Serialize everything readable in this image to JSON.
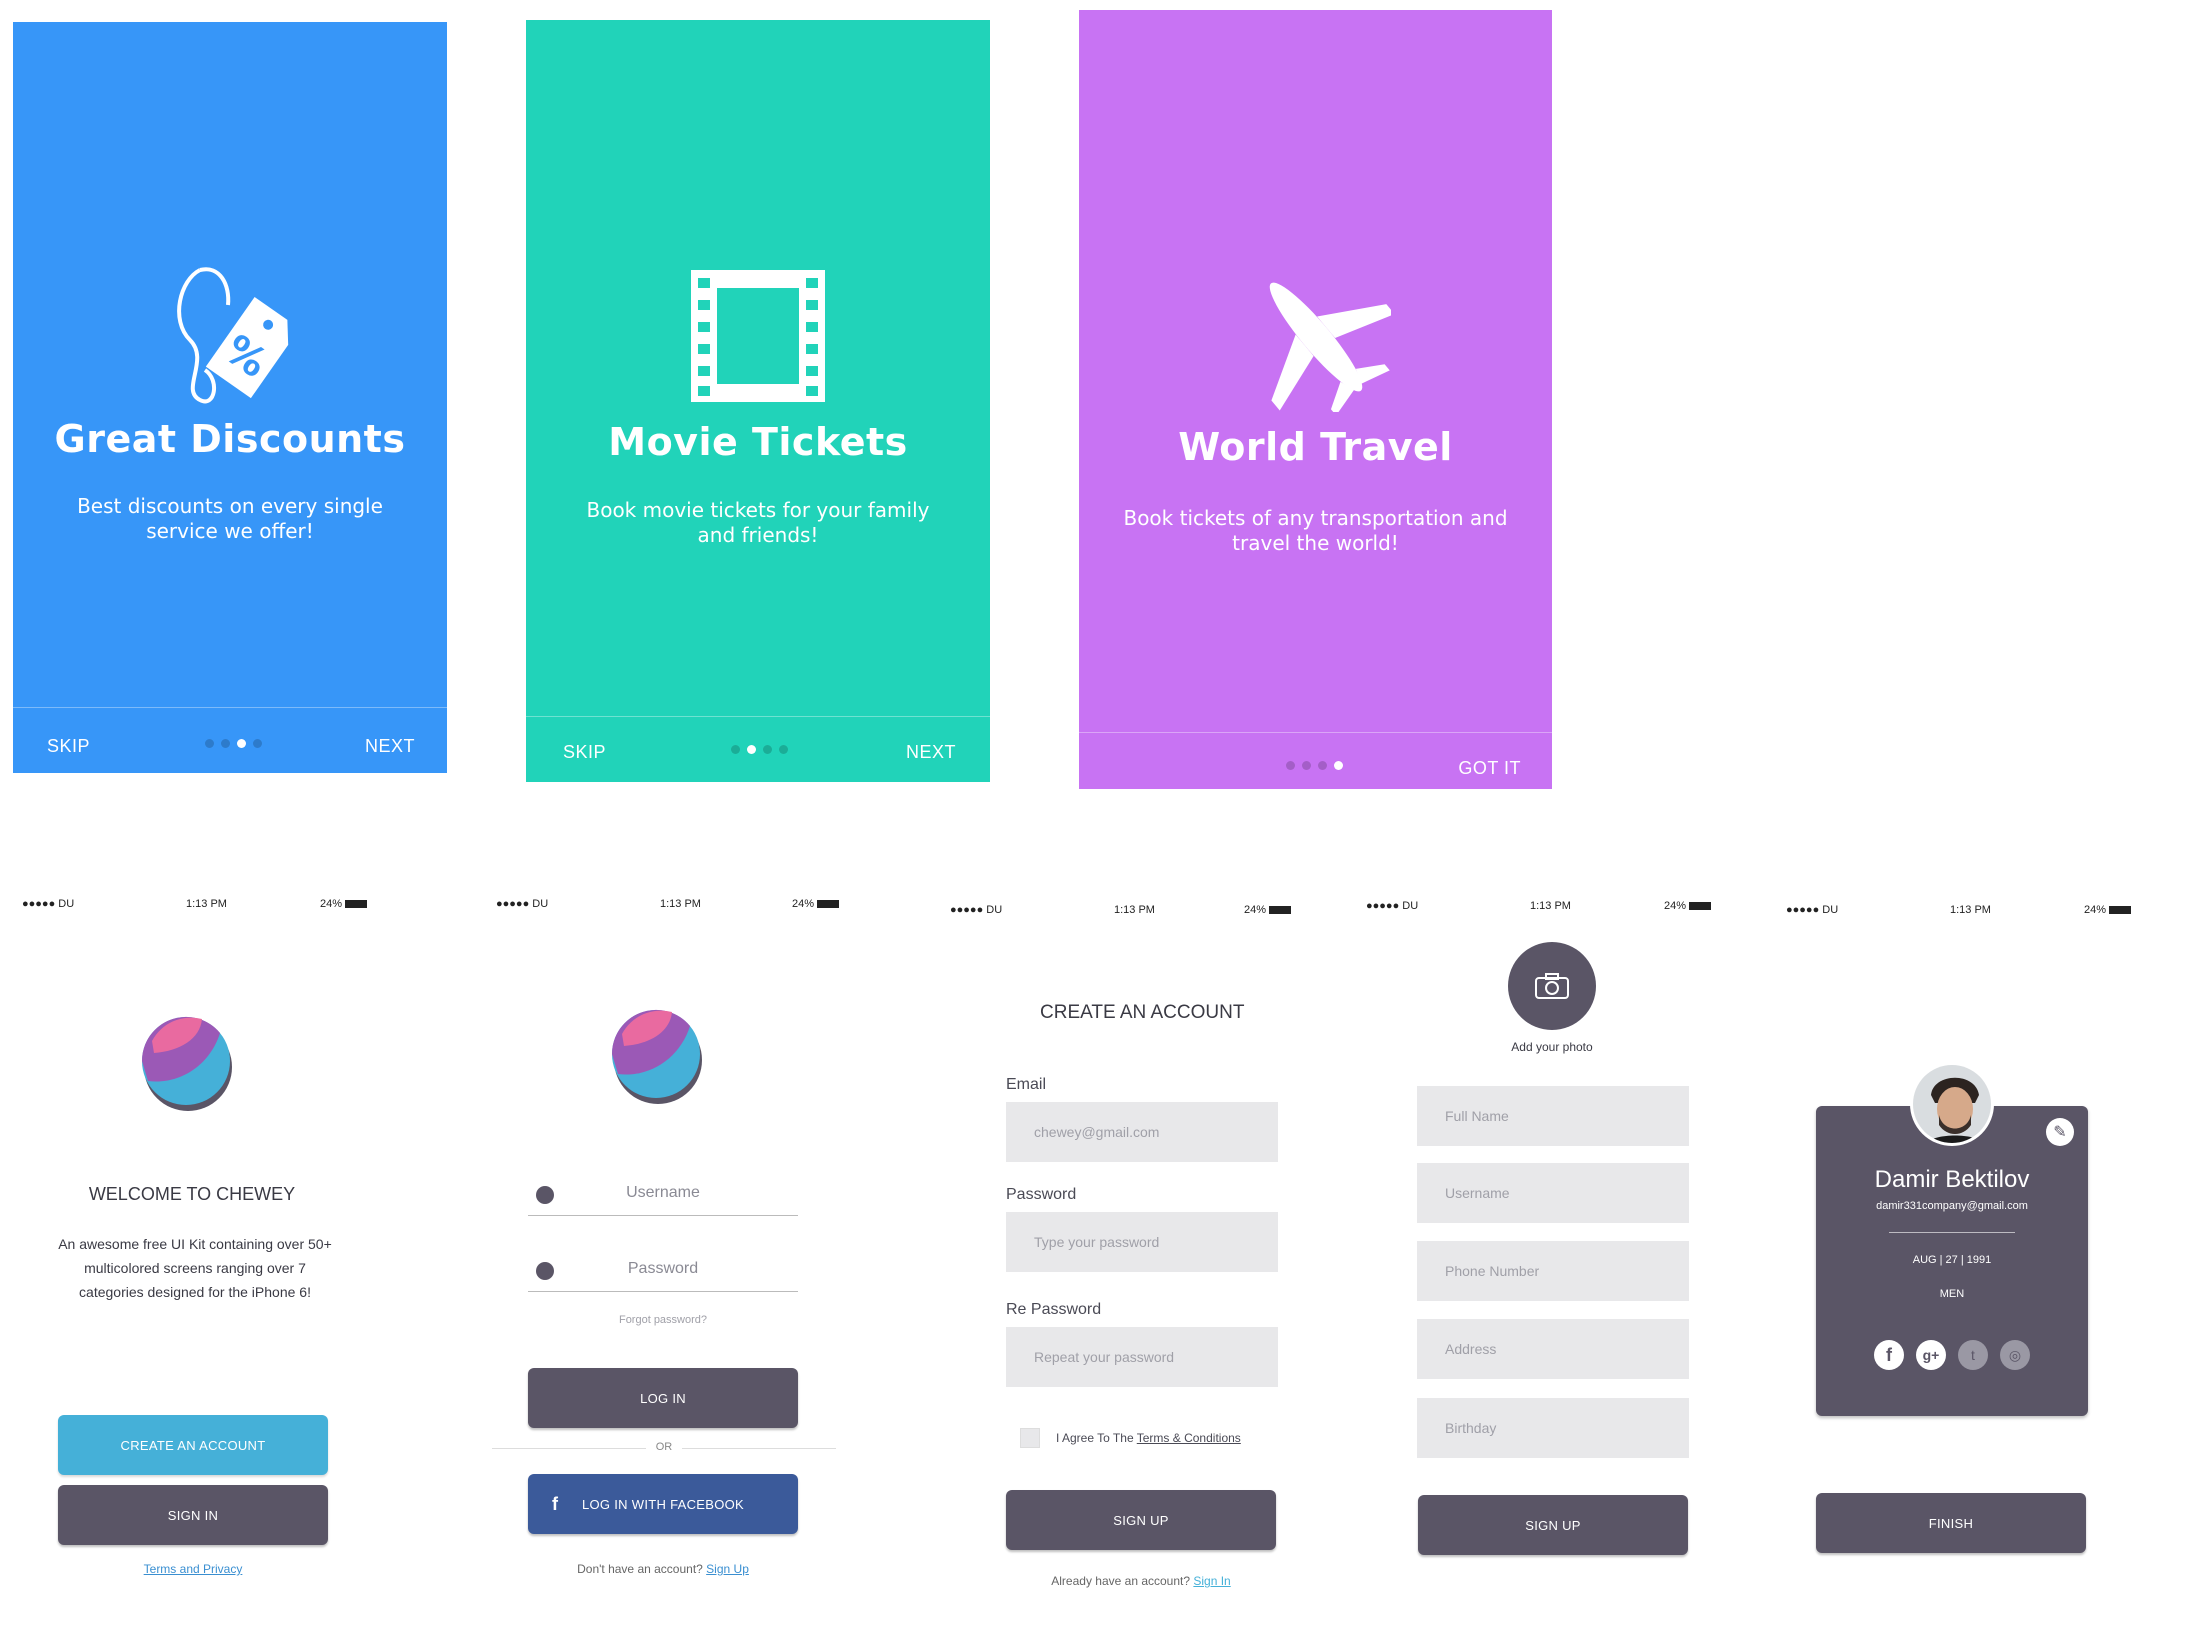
{
  "onboarding": [
    {
      "title": "Great Discounts",
      "subtitle": "Best discounts on every single service we offer!",
      "skip": "SKIP",
      "next": "NEXT",
      "bg": "#3796f8",
      "active_dot": 3,
      "icon": "discount-tag-icon"
    },
    {
      "title": "Movie Tickets",
      "subtitle": "Book movie tickets for your family and friends!",
      "skip": "SKIP",
      "next": "NEXT",
      "bg": "#21d3b9",
      "active_dot": 2,
      "icon": "film-strip-icon"
    },
    {
      "title": "World Travel",
      "subtitle": "Book tickets of any transportation and travel the world!",
      "next": "GOT IT",
      "bg": "#c873f3",
      "active_dot": 4,
      "icon": "airplane-icon"
    }
  ],
  "status_bar": {
    "carrier": "●●●●● DU",
    "time": "1:13 PM",
    "battery": "24%"
  },
  "welcome": {
    "title": "WELCOME TO CHEWEY",
    "description": "An awesome free UI Kit containing over 50+ multicolored screens ranging over 7 categories designed for the iPhone 6!",
    "create_account": "CREATE AN ACCOUNT",
    "sign_in": "SIGN IN",
    "terms": "Terms and Privacy"
  },
  "login": {
    "username_placeholder": "Username",
    "password_placeholder": "Password",
    "forgot": "Forgot password?",
    "login_button": "LOG IN",
    "or": "OR",
    "facebook_button": "LOG IN WITH FACEBOOK",
    "no_account": "Don't have an account?",
    "sign_up": "Sign Up"
  },
  "create_account": {
    "title": "CREATE AN ACCOUNT",
    "email_label": "Email",
    "email_value": "chewey@gmail.com",
    "password_label": "Password",
    "password_placeholder": "Type your password",
    "repassword_label": "Re Password",
    "repassword_placeholder": "Repeat your password",
    "agree_prefix": "I Agree To The",
    "agree_link": "Terms & Conditions",
    "signup_button": "SIGN UP",
    "have_account": "Already have an account?",
    "sign_in": "Sign In"
  },
  "profile_form": {
    "add_photo": "Add your photo",
    "fields": [
      "Full Name",
      "Username",
      "Phone Number",
      "Address",
      "Birthday"
    ],
    "signup_button": "SIGN UP"
  },
  "profile_card": {
    "name": "Damir Bektilov",
    "email": "damir331company@gmail.com",
    "birthday": "AUG | 27 | 1991",
    "gender": "MEN",
    "finish_button": "FINISH",
    "card_color": "#5a5566"
  }
}
